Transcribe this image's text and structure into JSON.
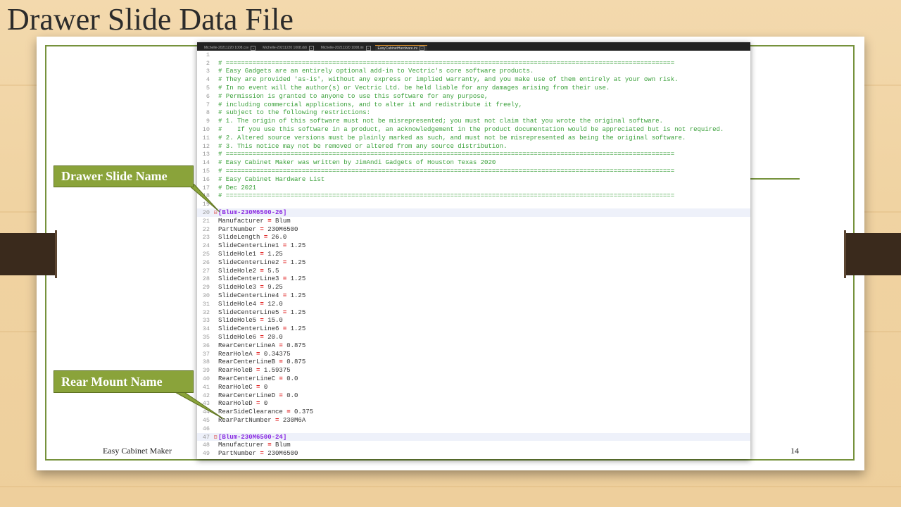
{
  "slide": {
    "title": "Drawer Slide Data File",
    "footer_left": "Easy Cabinet Maker",
    "page_number": "14"
  },
  "callouts": [
    {
      "label": "Drawer Slide Name"
    },
    {
      "label": "Rear Mount Name"
    }
  ],
  "editor": {
    "tabs": [
      {
        "label": "Michelle-20211220 1008.csv",
        "active": false
      },
      {
        "label": "Michelle-20211220 1008.ddi",
        "active": false
      },
      {
        "label": "Michelle-20211220 1008.ini",
        "active": false
      },
      {
        "label": "EasyCabinetHardware.ini",
        "active": true
      }
    ],
    "lines": [
      {
        "n": "1",
        "text": "",
        "kind": "plain"
      },
      {
        "n": "2",
        "text": "# ======================================================================================================================",
        "kind": "comment"
      },
      {
        "n": "3",
        "text": "# Easy Gadgets are an entirely optional add-in to Vectric's core software products.",
        "kind": "comment"
      },
      {
        "n": "4",
        "text": "# They are provided 'as-is', without any express or implied warranty, and you make use of them entirely at your own risk.",
        "kind": "comment"
      },
      {
        "n": "5",
        "text": "# In no event will the author(s) or Vectric Ltd. be held liable for any damages arising from their use.",
        "kind": "comment"
      },
      {
        "n": "6",
        "text": "# Permission is granted to anyone to use this software for any purpose,",
        "kind": "comment"
      },
      {
        "n": "7",
        "text": "# including commercial applications, and to alter it and redistribute it freely,",
        "kind": "comment"
      },
      {
        "n": "8",
        "text": "# subject to the following restrictions:",
        "kind": "comment"
      },
      {
        "n": "9",
        "text": "# 1. The origin of this software must not be misrepresented; you must not claim that you wrote the original software.",
        "kind": "comment"
      },
      {
        "n": "10",
        "text": "#    If you use this software in a product, an acknowledgement in the product documentation would be appreciated but is not required.",
        "kind": "comment"
      },
      {
        "n": "11",
        "text": "# 2. Altered source versions must be plainly marked as such, and must not be misrepresented as being the original software.",
        "kind": "comment"
      },
      {
        "n": "12",
        "text": "# 3. This notice may not be removed or altered from any source distribution.",
        "kind": "comment"
      },
      {
        "n": "13",
        "text": "# ======================================================================================================================",
        "kind": "comment"
      },
      {
        "n": "14",
        "text": "# Easy Cabinet Maker was written by JimAndi Gadgets of Houston Texas 2020",
        "kind": "comment"
      },
      {
        "n": "15",
        "text": "# ======================================================================================================================",
        "kind": "comment"
      },
      {
        "n": "16",
        "text": "# Easy Cabinet Hardware List",
        "kind": "comment"
      },
      {
        "n": "17",
        "text": "# Dec 2021",
        "kind": "comment"
      },
      {
        "n": "18",
        "text": "# ======================================================================================================================",
        "kind": "comment"
      },
      {
        "n": "19",
        "text": "",
        "kind": "plain"
      },
      {
        "n": "20",
        "text": "[Blum-230M6500-26]",
        "kind": "section"
      },
      {
        "n": "21",
        "key": "Manufacturer",
        "value": "Blum",
        "kind": "kv"
      },
      {
        "n": "22",
        "key": "PartNumber",
        "value": "230M6500",
        "kind": "kv"
      },
      {
        "n": "23",
        "key": "SlideLength",
        "value": "26.0",
        "kind": "kv"
      },
      {
        "n": "24",
        "key": "SlideCenterLine1",
        "value": "1.25",
        "kind": "kv"
      },
      {
        "n": "25",
        "key": "SlideHole1",
        "value": "1.25",
        "kind": "kv"
      },
      {
        "n": "26",
        "key": "SlideCenterLine2",
        "value": "1.25",
        "kind": "kv"
      },
      {
        "n": "27",
        "key": "SlideHole2",
        "value": "5.5",
        "kind": "kv"
      },
      {
        "n": "28",
        "key": "SlideCenterLine3",
        "value": "1.25",
        "kind": "kv"
      },
      {
        "n": "29",
        "key": "SlideHole3",
        "value": "9.25",
        "kind": "kv"
      },
      {
        "n": "30",
        "key": "SlideCenterLine4",
        "value": "1.25",
        "kind": "kv"
      },
      {
        "n": "31",
        "key": "SlideHole4",
        "value": "12.0",
        "kind": "kv"
      },
      {
        "n": "32",
        "key": "SlideCenterLine5",
        "value": "1.25",
        "kind": "kv"
      },
      {
        "n": "33",
        "key": "SlideHole5",
        "value": "15.0",
        "kind": "kv"
      },
      {
        "n": "34",
        "key": "SlideCenterLine6",
        "value": "1.25",
        "kind": "kv"
      },
      {
        "n": "35",
        "key": "SlideHole6",
        "value": "20.0",
        "kind": "kv"
      },
      {
        "n": "36",
        "key": "RearCenterLineA",
        "value": "0.875",
        "kind": "kv"
      },
      {
        "n": "37",
        "key": "RearHoleA",
        "value": "0.34375",
        "kind": "kv"
      },
      {
        "n": "38",
        "key": "RearCenterLineB",
        "value": "0.875",
        "kind": "kv"
      },
      {
        "n": "39",
        "key": "RearHoleB",
        "value": "1.59375",
        "kind": "kv"
      },
      {
        "n": "40",
        "key": "RearCenterLineC",
        "value": "0.0",
        "kind": "kv"
      },
      {
        "n": "41",
        "key": "RearHoleC",
        "value": "0",
        "kind": "kv"
      },
      {
        "n": "42",
        "key": "RearCenterLineD",
        "value": "0.0",
        "kind": "kv"
      },
      {
        "n": "43",
        "key": "RearHoleD",
        "value": "0",
        "kind": "kv"
      },
      {
        "n": "44",
        "key": "RearSideClearance",
        "value": "0.375",
        "kind": "kv"
      },
      {
        "n": "45",
        "key": "RearPartNumber",
        "value": "230M6A",
        "kind": "kv"
      },
      {
        "n": "46",
        "text": "",
        "kind": "plain"
      },
      {
        "n": "47",
        "text": "[Blum-230M6500-24]",
        "kind": "section"
      },
      {
        "n": "48",
        "key": "Manufacturer",
        "value": "Blum",
        "kind": "kv"
      },
      {
        "n": "49",
        "key": "PartNumber",
        "value": "230M6500",
        "kind": "kv"
      }
    ]
  },
  "colors": {
    "callout_fill": "#8aa33a",
    "frame": "#76923c",
    "comment": "#3aa03a",
    "section": "#8a2be2",
    "operator": "#e02020"
  }
}
